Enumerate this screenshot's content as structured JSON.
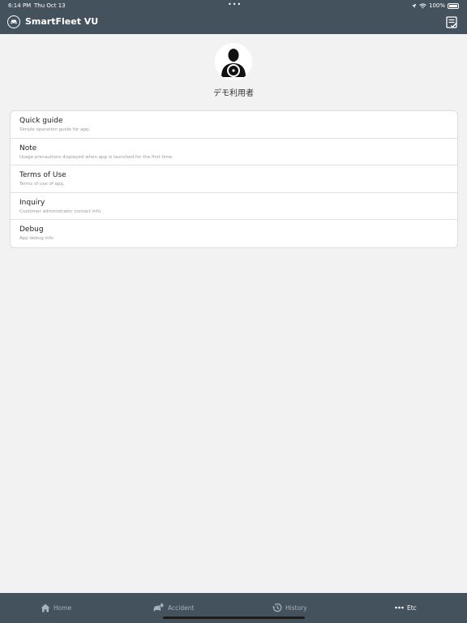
{
  "status_bar": {
    "time": "6:14 PM",
    "date": "Thu Oct 13",
    "battery": "100%"
  },
  "header": {
    "title": "SmartFleet VU"
  },
  "profile": {
    "name": "デモ利用者"
  },
  "menu": [
    {
      "title": "Quick guide",
      "subtitle": "Simple operation guide for app."
    },
    {
      "title": "Note",
      "subtitle": "Usage precautions displayed when app is launched for the first time."
    },
    {
      "title": "Terms of Use",
      "subtitle": "Terms of use of app."
    },
    {
      "title": "Inquiry",
      "subtitle": "Customer administrator contact info."
    },
    {
      "title": "Debug",
      "subtitle": "App debug info"
    }
  ],
  "tabs": [
    {
      "label": "Home",
      "icon": "home-icon",
      "active": false
    },
    {
      "label": "Accident",
      "icon": "accident-icon",
      "active": false
    },
    {
      "label": "History",
      "icon": "history-icon",
      "active": false
    },
    {
      "label": "Etc",
      "icon": "more-icon",
      "active": true
    }
  ],
  "colors": {
    "bar": "#44525e",
    "background": "#f2f2f2",
    "tab_inactive": "#a9b2ba"
  }
}
